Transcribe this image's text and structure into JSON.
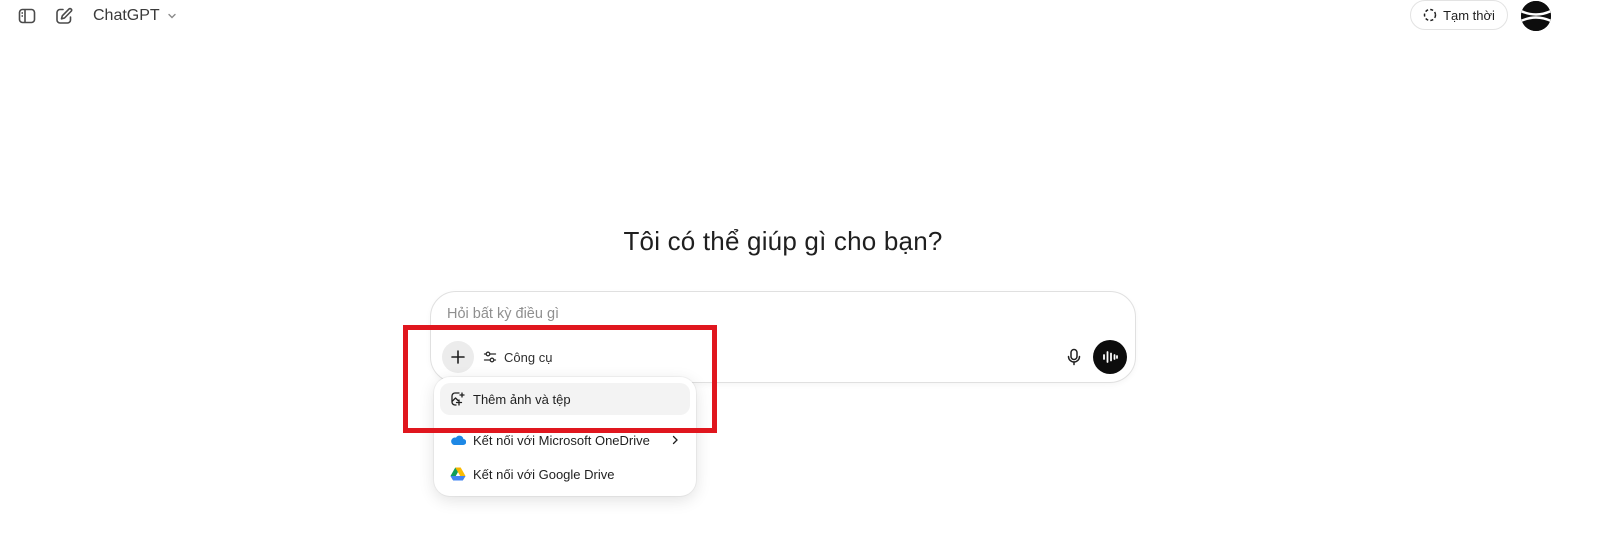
{
  "header": {
    "sidebar_toggle_icon": "sidebar-toggle-icon",
    "new_chat_icon": "compose-icon",
    "model_name": "ChatGPT",
    "temporary_label": "Tạm thời",
    "temporary_icon": "dashed-circle-icon",
    "avatar_icon": "user-avatar"
  },
  "main": {
    "title": "Tôi có thể giúp gì cho bạn?"
  },
  "composer": {
    "placeholder": "Hỏi bất kỳ điều gì",
    "value": "",
    "plus_icon": "plus-icon",
    "tools_label": "Công cụ",
    "tools_icon": "sliders-icon",
    "mic_icon": "microphone-icon",
    "voice_icon": "voice-waveform-icon"
  },
  "attach_menu": {
    "items": [
      {
        "label": "Thêm ảnh và tệp",
        "icon": "add-file-icon",
        "active": true
      },
      {
        "label": "Kết nối với Microsoft OneDrive",
        "icon": "onedrive-icon",
        "has_submenu": true
      },
      {
        "label": "Kết nối với Google Drive",
        "icon": "google-drive-icon"
      }
    ]
  },
  "colors": {
    "highlight": "#e0161e",
    "onedrive_blue": "#1e88e5",
    "voice_button": "#0d0d0d"
  }
}
